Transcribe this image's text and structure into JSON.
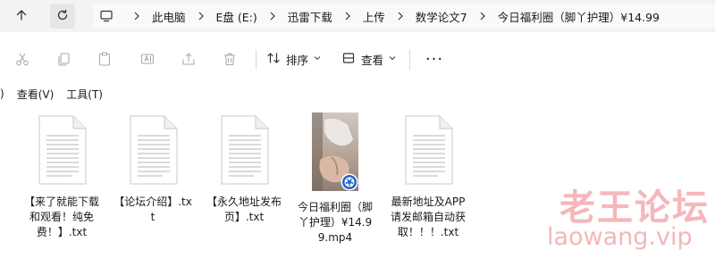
{
  "addressbar": {
    "crumbs": [
      "此电脑",
      "E盘 (E:)",
      "迅雷下载",
      "上传",
      "数学论文7",
      "今日福利圈（脚丫护理）¥14.99"
    ]
  },
  "toolbar": {
    "sort_label": "排序",
    "view_label": "查看",
    "more_label": "···"
  },
  "menubar": {
    "items": [
      ")",
      "查看(V)",
      "工具(T)"
    ]
  },
  "files": [
    {
      "name": "【来了就能下载和观看！纯免费！】.txt",
      "type": "txt"
    },
    {
      "name": "【论坛介绍】.txt",
      "type": "txt"
    },
    {
      "name": "【永久地址发布页】.txt",
      "type": "txt"
    },
    {
      "name": "今日福利圈（脚丫护理）¥14.99.mp4",
      "type": "video"
    },
    {
      "name": "最新地址及APP请发邮箱自动获取！！！.txt",
      "type": "txt"
    }
  ],
  "watermark": {
    "title": "老王论坛",
    "url": "laowang.vip"
  }
}
